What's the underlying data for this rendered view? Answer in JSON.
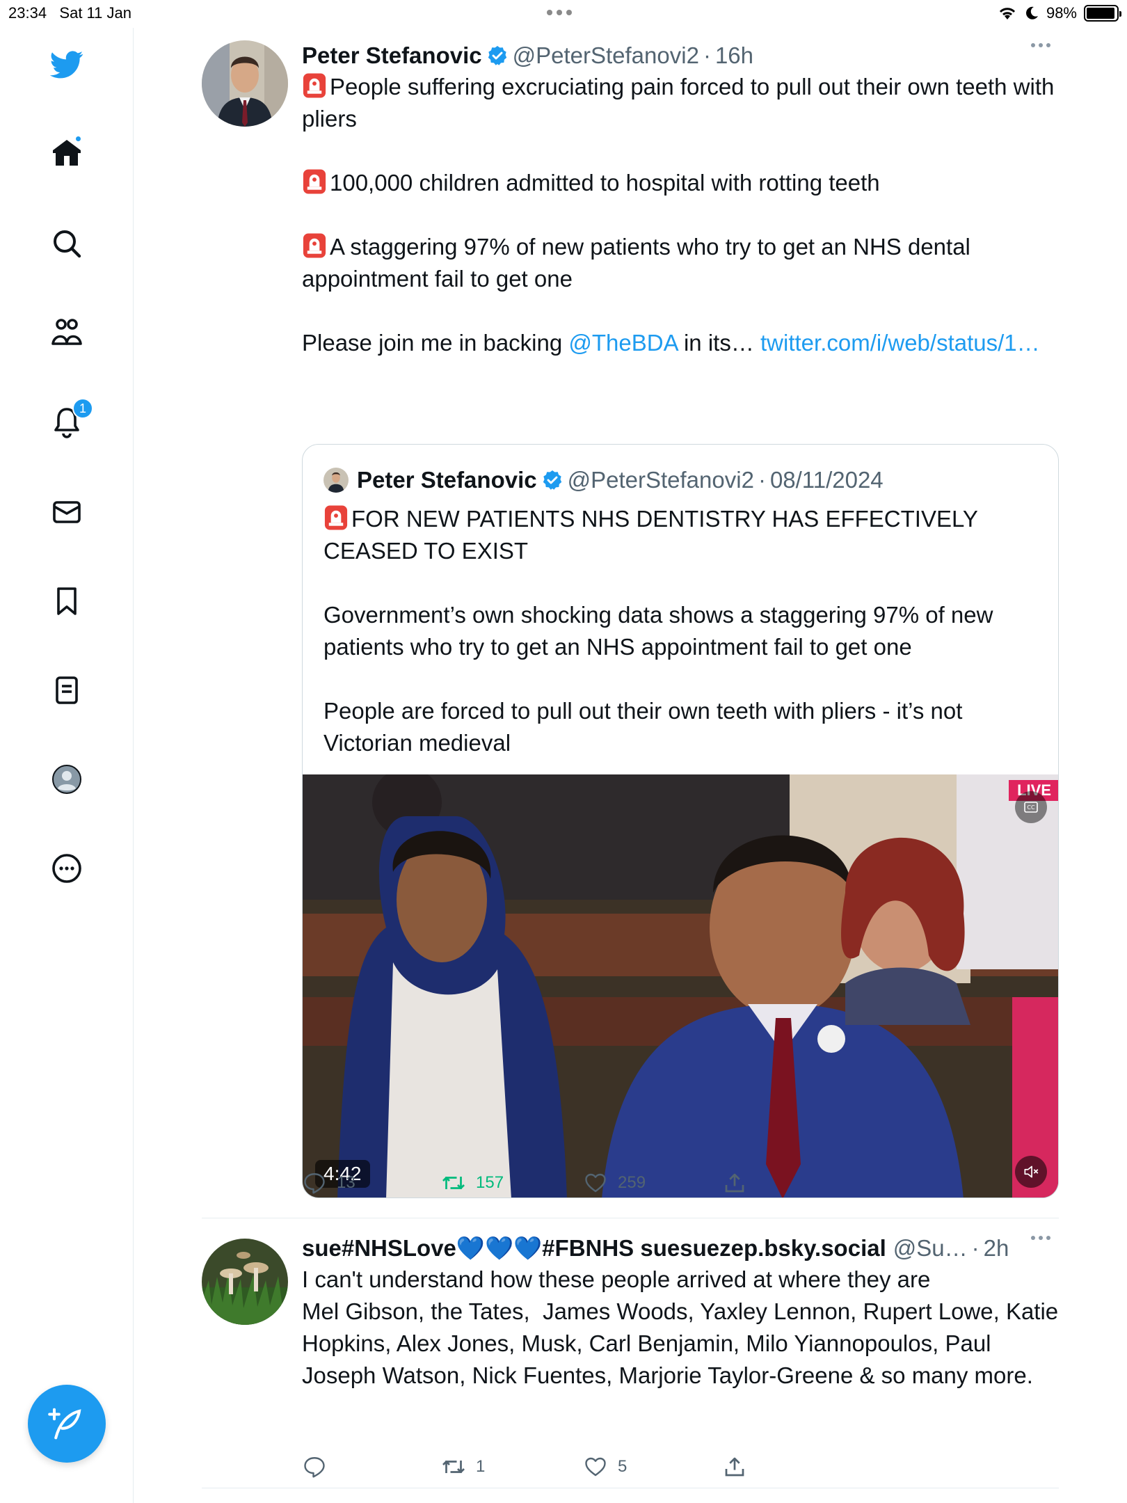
{
  "status_bar": {
    "time": "23:34",
    "date": "Sat 11 Jan",
    "battery": "98%",
    "battery_level": 0.98
  },
  "sidebar": {
    "items": [
      {
        "icon": "twitter-bird-icon"
      },
      {
        "icon": "home-icon",
        "has_dot": true
      },
      {
        "icon": "search-icon"
      },
      {
        "icon": "communities-icon"
      },
      {
        "icon": "notifications-bell-icon",
        "badge": "1"
      },
      {
        "icon": "messages-envelope-icon"
      },
      {
        "icon": "bookmark-icon"
      },
      {
        "icon": "lists-icon"
      },
      {
        "icon": "profile-icon"
      },
      {
        "icon": "more-circle-icon"
      }
    ],
    "compose_icon": "compose-feather-icon"
  },
  "tweet1": {
    "name": "Peter Stefanovic",
    "handle": "@PeterStefanovi2",
    "time": "16h",
    "line1": "People suffering excruciating pain forced to pull out their own teeth with pliers",
    "line2": "100,000 children admitted to hospital with rotting teeth",
    "line3": "A staggering 97% of new patients who try to get an NHS dental appointment fail to get one",
    "line4_prefix": "Please join me in backing ",
    "mention": "@TheBDA",
    "line4_mid": " in its… ",
    "link": "twitter.com/i/web/status/1…",
    "quote": {
      "name": "Peter Stefanovic",
      "handle": "@PeterStefanovi2",
      "date": "08/11/2024",
      "line1": "FOR NEW PATIENTS NHS DENTISTRY HAS EFFECTIVELY CEASED TO EXIST",
      "line2": "Government’s own shocking data shows a staggering 97% of new patients who try to get an NHS appointment fail to get one",
      "line3": "People are forced to pull out their own teeth with pliers - it’s not Victorian medieval",
      "video_duration": "4:42",
      "video_live": "LIVE"
    },
    "stats": {
      "replies": "13",
      "retweets": "157",
      "likes": "259"
    }
  },
  "tweet2": {
    "name": "sue#NHSLove💙💙💙#FBNHS suesuezep.bsky.social",
    "handle": "@Su…",
    "time": "2h",
    "text": "I can't understand how these people arrived at where they are\nMel Gibson, the Tates,  James Woods, Yaxley Lennon, Rupert Lowe, Katie Hopkins, Alex Jones, Musk, Carl Benjamin, Milo Yiannopoulos, Paul Joseph Watson, Nick Fuentes, Marjorie Taylor-Greene & so many more.",
    "stats": {
      "replies": "",
      "retweets": "1",
      "likes": "5"
    }
  },
  "colors": {
    "accent": "#1d9bf0",
    "retweet_green": "#00ba7c",
    "secondary_text": "#536471"
  }
}
